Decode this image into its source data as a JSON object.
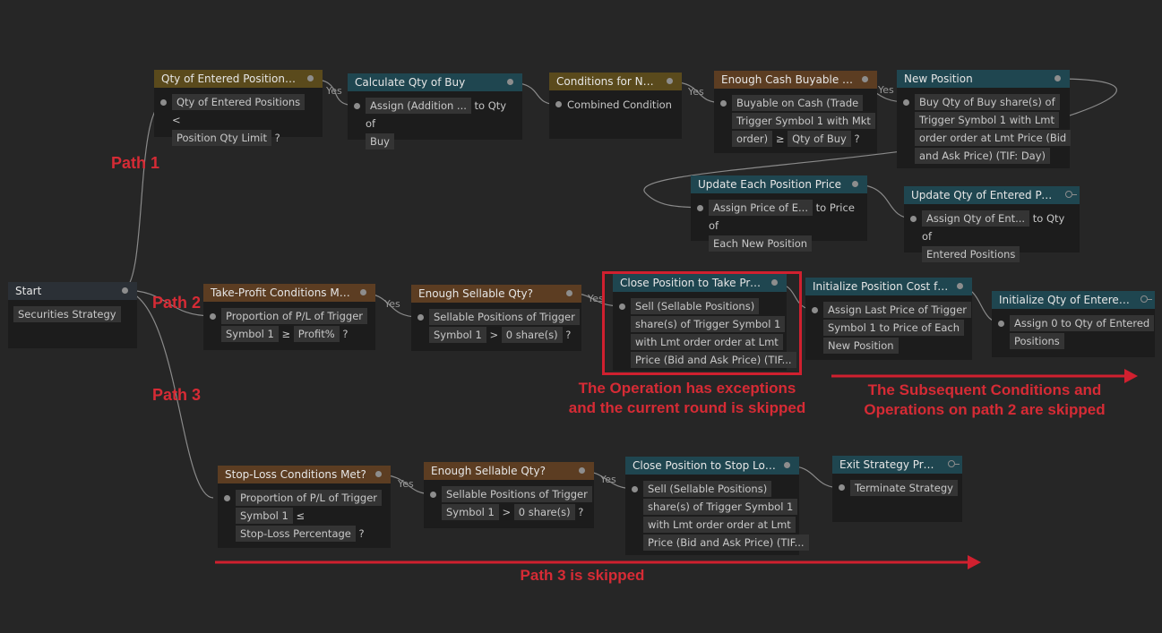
{
  "yes_label": "Yes",
  "nodes": {
    "start": {
      "title": "Start",
      "tokens": [
        "Securities Strategy"
      ]
    },
    "qty_limit": {
      "title": "Qty of Entered Positions L...",
      "tokens": [
        "Qty of Entered Positions",
        "<",
        "Position Qty Limit",
        "?"
      ]
    },
    "calc_qty": {
      "title": "Calculate Qty of Buy",
      "tokens": [
        "Assign (Addition ...",
        "to Qty of",
        "Buy"
      ]
    },
    "conditions_new": {
      "title": "Conditions for Ne...",
      "tokens": [
        "Combined Condition"
      ]
    },
    "enough_cash": {
      "title": "Enough Cash Buyable Qty?",
      "tokens": [
        "Buyable on Cash (Trade",
        "Trigger Symbol 1 with Mkt",
        "order)",
        "≥",
        "Qty of Buy",
        "?"
      ]
    },
    "new_position": {
      "title": "New Position",
      "tokens": [
        "Buy Qty of Buy share(s) of",
        "Trigger Symbol 1 with Lmt",
        "order order at Lmt Price (Bid",
        "and Ask Price) (TIF: Day)"
      ]
    },
    "update_price": {
      "title": "Update Each Position Price",
      "tokens": [
        "Assign Price of E...",
        "to Price of",
        "Each New Position"
      ]
    },
    "update_qty": {
      "title": "Update Qty of Entered Posi...",
      "tokens": [
        "Assign Qty of Ent...",
        "to Qty of",
        "Entered Positions"
      ]
    },
    "take_profit": {
      "title": "Take-Profit Conditions Met?",
      "tokens": [
        "Proportion of  P/L of Trigger",
        "Symbol 1",
        "≥",
        "Profit%",
        "?"
      ]
    },
    "sellable_tp": {
      "title": "Enough Sellable Qty?",
      "tokens": [
        "Sellable Positions of Trigger",
        "Symbol 1",
        ">",
        "0 share(s)",
        "?"
      ]
    },
    "close_tp": {
      "title": "Close Position to Take Profit",
      "tokens": [
        "Sell (Sellable Positions)",
        "share(s) of Trigger Symbol 1",
        "with Lmt order order at Lmt",
        "Price (Bid and Ask Price) (TIF..."
      ]
    },
    "init_cost": {
      "title": "Initialize Position Cost for ...",
      "tokens": [
        "Assign Last Price of Trigger",
        "Symbol 1 to Price of Each",
        "New Position"
      ]
    },
    "init_qty": {
      "title": "Initialize Qty of Entered ...",
      "tokens": [
        "Assign 0 to Qty of Entered",
        "Positions"
      ]
    },
    "stop_loss": {
      "title": "Stop-Loss Conditions Met?",
      "tokens": [
        "Proportion of  P/L of Trigger",
        "Symbol 1",
        "≤",
        "Stop-Loss Percentage",
        "?"
      ]
    },
    "sellable_sl": {
      "title": "Enough Sellable Qty?",
      "tokens": [
        "Sellable Positions of Trigger",
        "Symbol 1",
        ">",
        "0 share(s)",
        "?"
      ]
    },
    "close_sl": {
      "title": "Close Position to Stop Loss",
      "tokens": [
        "Sell (Sellable Positions)",
        "share(s) of Trigger Symbol 1",
        "with Lmt order order at Lmt",
        "Price (Bid and Ask Price) (TIF..."
      ]
    },
    "exit": {
      "title": "Exit Strategy Prog...",
      "tokens": [
        "Terminate Strategy"
      ]
    }
  },
  "annotations": {
    "path1": "Path 1",
    "path2": "Path 2",
    "path3": "Path 3",
    "exception_line1": "The Operation has exceptions",
    "exception_line2": "and the current round is skipped",
    "subsequent_line1": "The Subsequent Conditions and",
    "subsequent_line2": "Operations on path 2 are skipped",
    "path3_skipped": "Path 3 is skipped"
  },
  "colors": {
    "annotation_red": "#d62b35",
    "wire": "#9a9a9a"
  }
}
